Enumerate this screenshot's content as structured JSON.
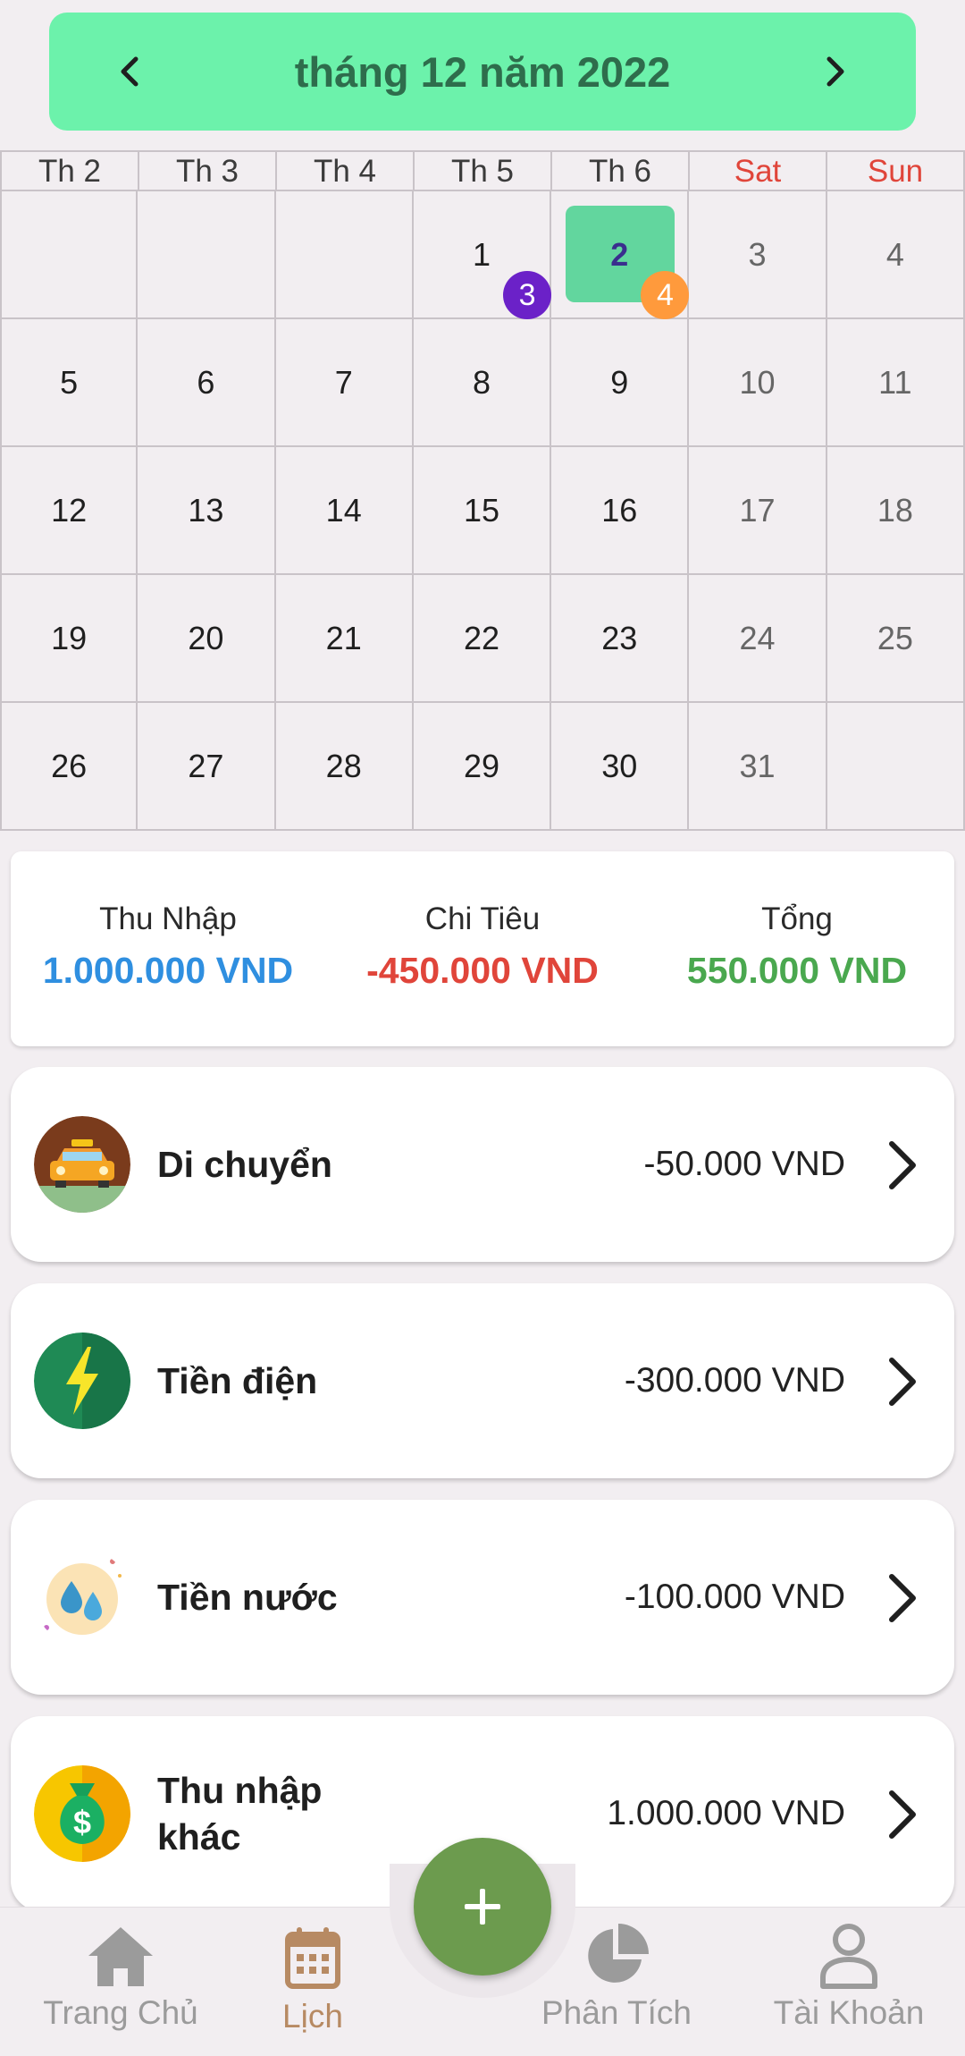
{
  "header": {
    "title": "tháng 12 năm 2022"
  },
  "weekdays": [
    "Th 2",
    "Th 3",
    "Th 4",
    "Th 5",
    "Th 6",
    "Sat",
    "Sun"
  ],
  "calendar": {
    "selected_day": "2",
    "badges": [
      {
        "day": "1",
        "count": "3",
        "color": "#6b21c8"
      },
      {
        "day": "2",
        "count": "4",
        "color": "#ff9a3c"
      }
    ]
  },
  "summary": {
    "income_label": "Thu Nhập",
    "income_value": "1.000.000 VND",
    "expense_label": "Chi Tiêu",
    "expense_value": "-450.000 VND",
    "total_label": "Tổng",
    "total_value": "550.000 VND",
    "income_color": "#2f8fe0",
    "expense_color": "#e0453a",
    "total_color": "#4aa84f"
  },
  "transactions": [
    {
      "name": "Di chuyển",
      "amount": "-50.000 VND",
      "icon": "taxi-icon"
    },
    {
      "name": "Tiền điện",
      "amount": "-300.000 VND",
      "icon": "lightning-icon"
    },
    {
      "name": "Tiền nước",
      "amount": "-100.000 VND",
      "icon": "water-drops-icon"
    },
    {
      "name": "Thu nhập khác",
      "amount": "1.000.000 VND",
      "icon": "money-bag-icon"
    }
  ],
  "bottom_nav": [
    {
      "label": "Trang Chủ",
      "icon": "home-icon"
    },
    {
      "label": "Lịch",
      "icon": "calendar-icon",
      "active": true
    },
    {
      "label": "Phân Tích",
      "icon": "pie-chart-icon"
    },
    {
      "label": "Tài Khoản",
      "icon": "user-icon"
    }
  ],
  "fab": {
    "icon": "plus-icon"
  }
}
